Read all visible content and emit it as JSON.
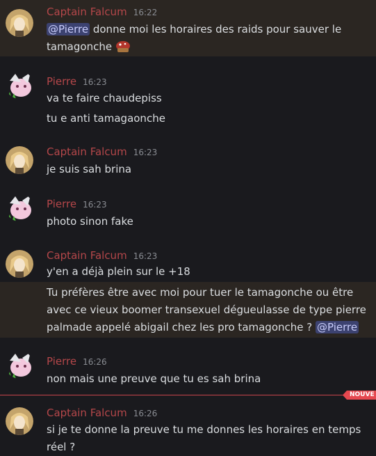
{
  "messages": [
    {
      "username": "Captain Falcum",
      "time": "16:22",
      "mention": "@Pierre",
      "line1_rest": " donne moi les horaires des raids pour sauver le",
      "line2": "tamagonche "
    },
    {
      "username": "Pierre",
      "time": "16:23",
      "lines": [
        "va te faire chaudepiss",
        "tu e anti tamagaonche"
      ]
    },
    {
      "username": "Captain Falcum",
      "time": "16:23",
      "lines": [
        "je suis sah brina"
      ]
    },
    {
      "username": "Pierre",
      "time": "16:23",
      "lines": [
        "photo sinon fake"
      ]
    },
    {
      "username": "Captain Falcum",
      "time": "16:23",
      "lines": [
        "y'en a déjà plein sur le +18"
      ]
    },
    {
      "followup_lines": [
        "Tu préfères être avec moi pour tuer le tamagonche ou être",
        "avec ce vieux boomer transexuel dégueulasse de type pierre",
        "palmade appelé abigail chez les pro tamagonche ? "
      ],
      "mention": "@Pierre"
    },
    {
      "username": "Pierre",
      "time": "16:26",
      "lines": [
        "non mais une preuve que tu es sah brina"
      ]
    },
    {
      "username": "Captain Falcum",
      "time": "16:26",
      "lines": [
        "si je te donne la preuve tu me donnes les horaires en temps",
        "réel ?"
      ]
    }
  ],
  "divider": {
    "label": "NOUVE",
    "color": "#e5484f"
  },
  "colors": {
    "username": "#b5474a",
    "mention_bg": "#3c4270",
    "highlight_bg": "#2b2622"
  },
  "icons": {
    "falcum_avatar": "falcum-avatar",
    "pierre_avatar": "pierre-avatar",
    "emoji": "mushroom-emoji"
  }
}
